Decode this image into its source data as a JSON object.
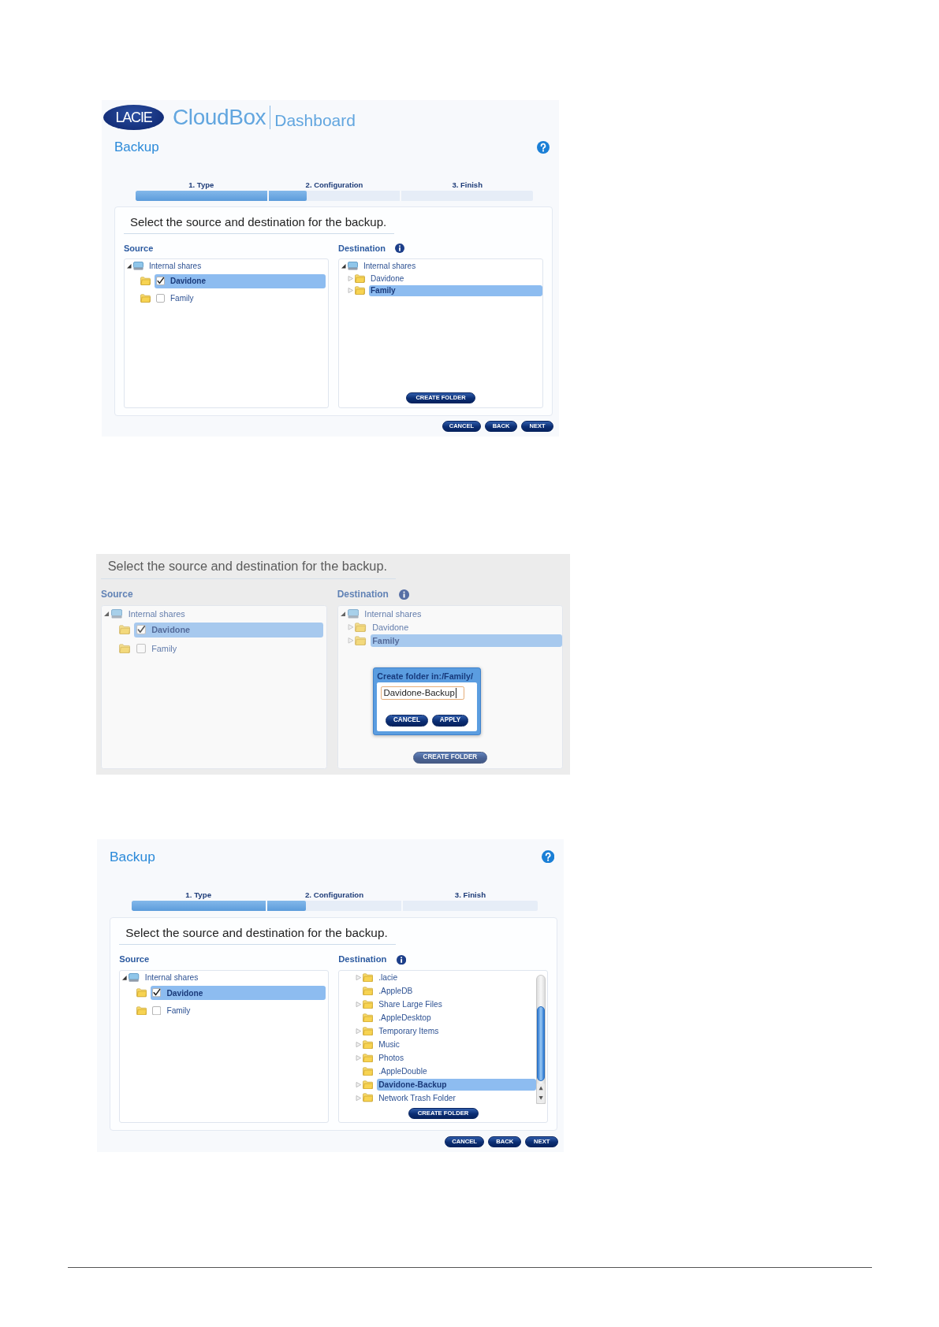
{
  "screenshots": [
    {
      "dimmed": false,
      "logo": {
        "brand": "LACIE",
        "product": "CloudBox",
        "section": "Dashboard"
      },
      "title": "Backup",
      "steps": [
        {
          "label": "1. Type"
        },
        {
          "label": "2. Configuration"
        },
        {
          "label": "3. Finish"
        }
      ],
      "progress": {
        "level": 0.43
      },
      "instruction": "Select the source and destination for the backup.",
      "source": {
        "label": "Source",
        "tree": [
          {
            "kind": "drive",
            "label": "Internal shares",
            "expanded": true,
            "selected": false,
            "children": [
              {
                "kind": "folder",
                "label": "Davidone",
                "checked": true,
                "selected": true
              },
              {
                "kind": "folder",
                "label": "Family",
                "checked": false,
                "selected": false
              }
            ]
          }
        ]
      },
      "destination": {
        "label": "Destination",
        "tree": [
          {
            "kind": "drive",
            "label": "Internal shares",
            "expanded": true,
            "selected": false,
            "children": [
              {
                "kind": "folder",
                "label": "Davidone",
                "expanded": false,
                "selected": false
              },
              {
                "kind": "folder",
                "label": "Family",
                "expanded": false,
                "selected": true
              }
            ]
          }
        ],
        "create_folder_button": "CREATE FOLDER"
      },
      "buttons": {
        "cancel": "CANCEL",
        "back": "BACK",
        "next": "NEXT"
      }
    },
    {
      "dimmed": true,
      "instruction": "Select the source and destination for the backup.",
      "source": {
        "label": "Source",
        "tree": [
          {
            "kind": "drive",
            "label": "Internal shares",
            "expanded": true,
            "selected": false,
            "children": [
              {
                "kind": "folder",
                "label": "Davidone",
                "checked": true,
                "selected": true
              },
              {
                "kind": "folder",
                "label": "Family",
                "checked": false,
                "selected": false
              }
            ]
          }
        ]
      },
      "destination": {
        "label": "Destination",
        "tree": [
          {
            "kind": "drive",
            "label": "Internal shares",
            "expanded": true,
            "selected": false,
            "children": [
              {
                "kind": "folder",
                "label": "Davidone",
                "expanded": false,
                "selected": false
              },
              {
                "kind": "folder",
                "label": "Family",
                "expanded": false,
                "selected": true
              }
            ]
          }
        ],
        "create_folder_button": "CREATE FOLDER",
        "dialog": {
          "title": "Create folder in:/Family/",
          "value": "Davidone-Backup",
          "buttons": {
            "cancel": "CANCEL",
            "apply": "APPLY"
          }
        }
      }
    },
    {
      "dimmed": false,
      "title": "Backup",
      "steps": [
        {
          "label": "1. Type"
        },
        {
          "label": "2. Configuration"
        },
        {
          "label": "3. Finish"
        }
      ],
      "progress": {
        "level": 0.43
      },
      "instruction": "Select the source and destination for the backup.",
      "source": {
        "label": "Source",
        "tree": [
          {
            "kind": "drive",
            "label": "Internal shares",
            "expanded": true,
            "selected": false,
            "children": [
              {
                "kind": "folder",
                "label": "Davidone",
                "checked": true,
                "selected": true
              },
              {
                "kind": "folder",
                "label": "Family",
                "checked": false,
                "selected": false
              }
            ]
          }
        ]
      },
      "destination": {
        "label": "Destination",
        "scrollbar": true,
        "tree": [
          {
            "kind": "folder",
            "label": ".lacie",
            "expanded": false,
            "selected": false
          },
          {
            "kind": "folder",
            "label": ".AppleDB",
            "selected": false
          },
          {
            "kind": "folder",
            "label": "Share Large Files",
            "expanded": false,
            "selected": false
          },
          {
            "kind": "folder",
            "label": ".AppleDesktop",
            "selected": false
          },
          {
            "kind": "folder",
            "label": "Temporary Items",
            "expanded": false,
            "selected": false
          },
          {
            "kind": "folder",
            "label": "Music",
            "expanded": false,
            "selected": false
          },
          {
            "kind": "folder",
            "label": "Photos",
            "expanded": false,
            "selected": false
          },
          {
            "kind": "folder",
            "label": ".AppleDouble",
            "selected": false
          },
          {
            "kind": "folder",
            "label": "Davidone-Backup",
            "expanded": false,
            "selected": true
          },
          {
            "kind": "folder",
            "label": "Network Trash Folder",
            "expanded": false,
            "selected": false
          }
        ],
        "create_folder_button": "CREATE FOLDER"
      },
      "buttons": {
        "cancel": "CANCEL",
        "back": "BACK",
        "next": "NEXT"
      }
    }
  ]
}
